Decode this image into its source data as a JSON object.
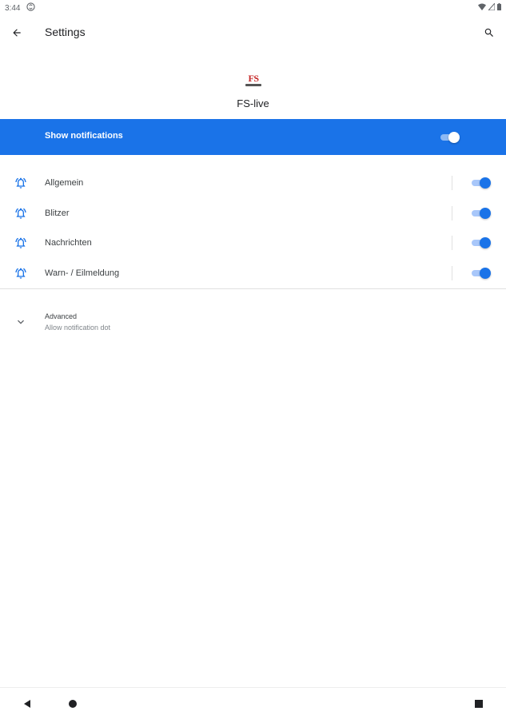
{
  "status_bar": {
    "time": "3:44"
  },
  "toolbar": {
    "title": "Settings"
  },
  "app": {
    "name": "FS-live",
    "logo_text": "FS"
  },
  "master": {
    "label": "Show notifications",
    "enabled": true
  },
  "channels": [
    {
      "label": "Allgemein",
      "enabled": true
    },
    {
      "label": "Blitzer",
      "enabled": true
    },
    {
      "label": "Nachrichten",
      "enabled": true
    },
    {
      "label": "Warn- / Eilmeldung",
      "enabled": true
    }
  ],
  "advanced": {
    "title": "Advanced",
    "summary": "Allow notification dot"
  },
  "colors": {
    "accent": "#1a73e8",
    "logo_red": "#c62828"
  },
  "icons": {
    "back": "arrow-back-icon",
    "search": "search-icon",
    "channel": "bell-ringing-icon",
    "expand": "chevron-down-icon"
  }
}
